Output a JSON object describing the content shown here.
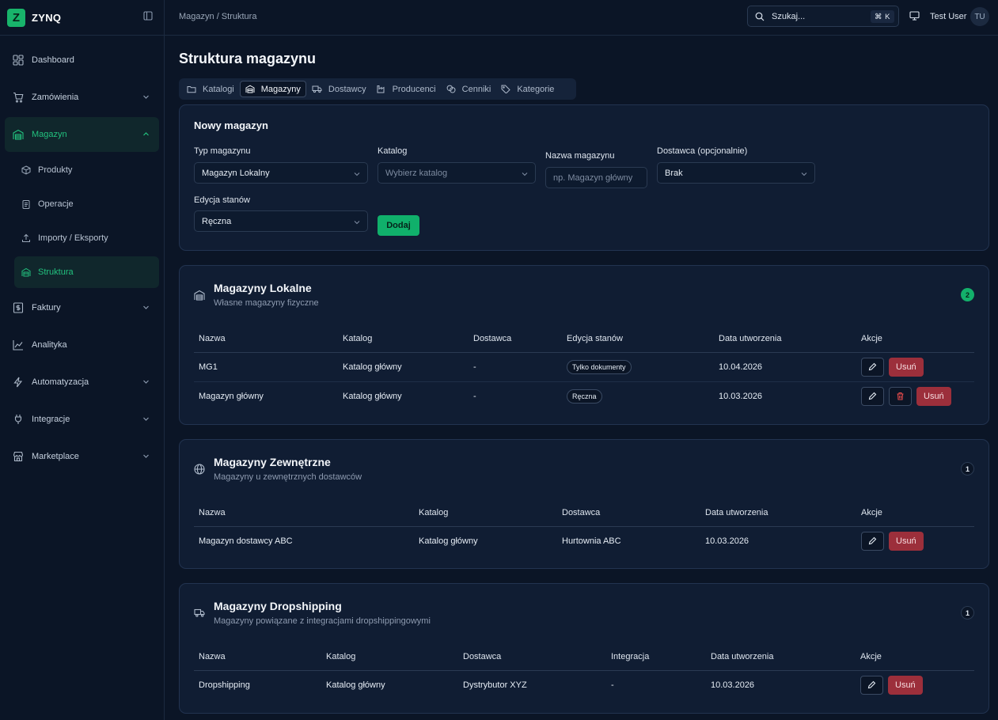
{
  "app": {
    "logo_letter": "Z",
    "name": "ZYNQ"
  },
  "sidebar": {
    "items": [
      {
        "label": "Dashboard",
        "icon": "dashboard-grid-icon"
      },
      {
        "label": "Zamówienia",
        "icon": "cart-icon",
        "expandable": true
      },
      {
        "label": "Magazyn",
        "icon": "warehouse-icon",
        "expandable": true,
        "expanded": true
      },
      {
        "label": "Faktury",
        "icon": "invoice-dollar-icon",
        "expandable": true
      },
      {
        "label": "Analityka",
        "icon": "chart-line-icon"
      },
      {
        "label": "Automatyzacja",
        "icon": "lightning-icon",
        "expandable": true
      },
      {
        "label": "Integracje",
        "icon": "plug-icon",
        "expandable": true
      },
      {
        "label": "Marketplace",
        "icon": "store-icon",
        "expandable": true
      }
    ],
    "magazyn_sub": [
      {
        "label": "Produkty",
        "icon": "package-icon"
      },
      {
        "label": "Operacje",
        "icon": "clipboard-icon"
      },
      {
        "label": "Importy / Eksporty",
        "icon": "upload-icon"
      },
      {
        "label": "Struktura",
        "icon": "warehouse-icon",
        "active": true
      }
    ]
  },
  "topbar": {
    "breadcrumb": "Magazyn / Struktura",
    "search_placeholder": "Szukaj...",
    "shortcut": "⌘ K",
    "user_name": "Test User",
    "user_initials": "TU"
  },
  "page": {
    "title": "Struktura magazynu"
  },
  "tabs": [
    {
      "label": "Katalogi",
      "icon": "folder-icon"
    },
    {
      "label": "Magazyny",
      "icon": "warehouse-icon",
      "active": true
    },
    {
      "label": "Dostawcy",
      "icon": "truck-icon"
    },
    {
      "label": "Producenci",
      "icon": "factory-icon"
    },
    {
      "label": "Cenniki",
      "icon": "coins-icon"
    },
    {
      "label": "Kategorie",
      "icon": "tag-icon"
    }
  ],
  "new_warehouse": {
    "title": "Nowy magazyn",
    "type_label": "Typ magazynu",
    "type_value": "Magazyn Lokalny",
    "catalog_label": "Katalog",
    "catalog_placeholder": "Wybierz katalog",
    "name_label": "Nazwa magazynu",
    "name_placeholder": "np. Magazyn główny",
    "supplier_label": "Dostawca (opcjonalnie)",
    "supplier_value": "Brak",
    "stock_label": "Edycja stanów",
    "stock_value": "Ręczna",
    "add_button": "Dodaj"
  },
  "local": {
    "title": "Magazyny Lokalne",
    "subtitle": "Własne magazyny fizyczne",
    "count": "2",
    "columns": [
      "Nazwa",
      "Katalog",
      "Dostawca",
      "Edycja stanów",
      "Data utworzenia",
      "Akcje"
    ],
    "rows": [
      {
        "name": "MG1",
        "catalog": "Katalog główny",
        "supplier": "-",
        "stock": "Tylko dokumenty",
        "date": "10.04.2026",
        "delete": "Usuń"
      },
      {
        "name": "Magazyn główny",
        "catalog": "Katalog główny",
        "supplier": "-",
        "stock": "Ręczna",
        "date": "10.03.2026",
        "delete": "Usuń"
      }
    ]
  },
  "external": {
    "title": "Magazyny Zewnętrzne",
    "subtitle": "Magazyny u zewnętrznych dostawców",
    "count": "1",
    "columns": [
      "Nazwa",
      "Katalog",
      "Dostawca",
      "Data utworzenia",
      "Akcje"
    ],
    "rows": [
      {
        "name": "Magazyn dostawcy ABC",
        "catalog": "Katalog główny",
        "supplier": "Hurtownia ABC",
        "date": "10.03.2026",
        "delete": "Usuń"
      }
    ]
  },
  "dropship": {
    "title": "Magazyny Dropshipping",
    "subtitle": "Magazyny powiązane z integracjami dropshippingowymi",
    "count": "1",
    "columns": [
      "Nazwa",
      "Katalog",
      "Dostawca",
      "Integracja",
      "Data utworzenia",
      "Akcje"
    ],
    "rows": [
      {
        "name": "Dropshipping",
        "catalog": "Katalog główny",
        "supplier": "Dystrybutor XYZ",
        "integration": "-",
        "date": "10.03.2026",
        "delete": "Usuń"
      }
    ]
  },
  "colors": {
    "accent": "#18b46b",
    "danger": "#9c2f3b",
    "background": "#0b1526",
    "card": "#101d33"
  }
}
